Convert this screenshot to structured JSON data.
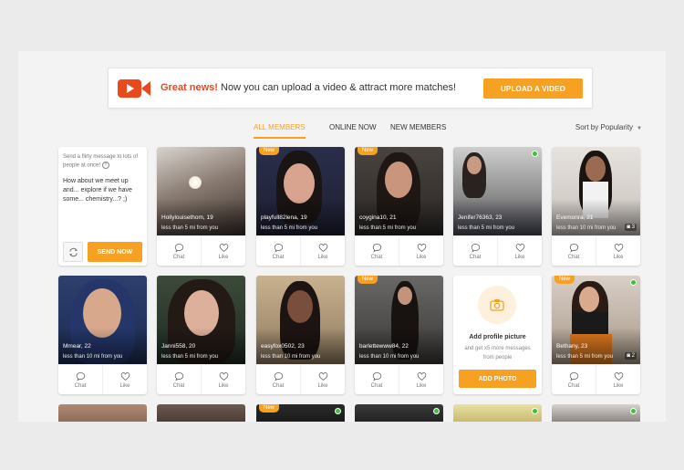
{
  "banner": {
    "highlight": "Great news!",
    "text": " Now you can upload a video & attract more matches!",
    "button": "UPLOAD A VIDEO",
    "icon": "video-camera-icon"
  },
  "tabs": [
    {
      "label": "ALL MEMBERS",
      "active": true
    },
    {
      "label": "ONLINE NOW",
      "active": false
    },
    {
      "label": "NEW MEMBERS",
      "active": false
    }
  ],
  "sort": {
    "label": "Sort by Popularity"
  },
  "message_card": {
    "hint": "Send a flirty message to lots of people at once!",
    "message": "How about we meet up and... explore if we have some... chemistry...? ;)",
    "send_button": "SEND NOW"
  },
  "add_photo": {
    "title": "Add profile picture",
    "subtitle": "and get x5 more messages from people",
    "button": "ADD PHOTO"
  },
  "actions": {
    "chat": "Chat",
    "like": "Like"
  },
  "new_badge": "New",
  "members": [
    {
      "name": "Hollylouisethom, 19",
      "distance": "less than 5 mi from you",
      "is_new": false,
      "online": false,
      "photos": ""
    },
    {
      "name": "playfull82lena, 19",
      "distance": "less than 5 mi from you",
      "is_new": true,
      "online": false,
      "photos": ""
    },
    {
      "name": "coygina10, 21",
      "distance": "less than 5 mi from you",
      "is_new": true,
      "online": false,
      "photos": ""
    },
    {
      "name": "Jenifer76363, 23",
      "distance": "less than 5 mi from you",
      "is_new": false,
      "online": true,
      "photos": ""
    },
    {
      "name": "Evemonra, 21",
      "distance": "less than 10 mi from you",
      "is_new": false,
      "online": false,
      "photos": "3"
    },
    {
      "name": "Mmear, 22",
      "distance": "less than 10 mi from you",
      "is_new": false,
      "online": false,
      "photos": ""
    },
    {
      "name": "Janni558, 20",
      "distance": "less than 5 mi from you",
      "is_new": false,
      "online": false,
      "photos": ""
    },
    {
      "name": "easyfox0502, 23",
      "distance": "less than 10 mi from you",
      "is_new": false,
      "online": false,
      "photos": ""
    },
    {
      "name": "barlettewww84, 22",
      "distance": "less than 10 mi from you",
      "is_new": true,
      "online": false,
      "photos": ""
    },
    {
      "name": "Bethany, 23",
      "distance": "less than 5 mi from you",
      "is_new": true,
      "online": true,
      "photos": "2"
    }
  ]
}
